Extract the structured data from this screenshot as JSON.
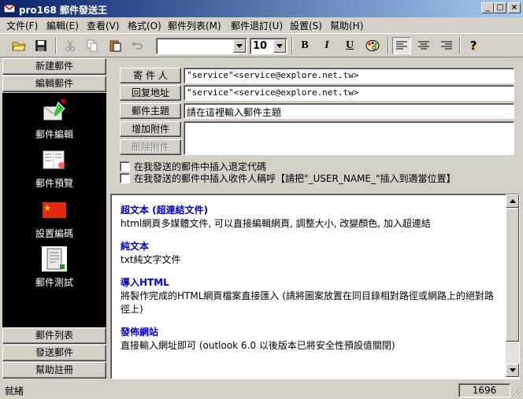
{
  "window": {
    "title": "pro168 郵件發送王",
    "controls": [
      "_",
      "□",
      "×"
    ]
  },
  "menu": [
    {
      "label": "文件(F)"
    },
    {
      "label": "編輯(E)"
    },
    {
      "label": "查看(V)"
    },
    {
      "label": "格式(O)"
    },
    {
      "label": "郵件列表(M)"
    },
    {
      "label": "郵件退訂(U)"
    },
    {
      "label": "設置(S)"
    },
    {
      "label": "幫助(H)"
    }
  ],
  "toolbar": {
    "font_name": "",
    "font_size": "10",
    "bold": "B",
    "italic": "I",
    "underline": "U",
    "help": "?"
  },
  "sidebar": {
    "top_tabs": [
      "新建郵件",
      "編輯郵件"
    ],
    "items": [
      {
        "label": "郵件編輯",
        "icon": "mail-edit-icon"
      },
      {
        "label": "郵件預覽",
        "icon": "book-icon"
      },
      {
        "label": "設置編碼",
        "icon": "flag-icon"
      },
      {
        "label": "郵件測試",
        "icon": "scroll-icon"
      }
    ],
    "bottom_tabs": [
      "郵件列表",
      "發送郵件",
      "幫助註冊"
    ]
  },
  "form": {
    "sender_label": "寄 件 人",
    "sender_value": "\"service\"<service@explore.net.tw>",
    "reply_label": "回复地址",
    "reply_value": "\"service\"<service@explore.net.tw>",
    "subject_label": "郵件主題",
    "subject_value": "請在這裡輸入郵件主題",
    "add_attachment": "增加附件",
    "remove_attachment": "刪除附件",
    "check_unsubscribe": "在我發送的郵件中插入退定代碼",
    "check_recipient": "在我發送的郵件中插入收件人稱呼【請把\"_USER_NAME_\"插入到適當位置】"
  },
  "content": {
    "sections": [
      {
        "title": "超文本 (超連結文件)",
        "desc": "html網頁多媒體文件, 可以直接編輯網頁, 調整大小, 改變顏色, 加入超連結"
      },
      {
        "title": "純文本",
        "desc": "txt純文字文件"
      },
      {
        "title": "導入HTML",
        "desc": "將製作完成的HTML網頁檔案直接匯入 (請將圖案放置在同目錄相對路徑或網路上的絕對路徑上)"
      },
      {
        "title": "發佈網站",
        "desc": "直接輸入網址即可 (outlook 6.0 以後版本已將安全性預設值關閉)"
      }
    ]
  },
  "status": {
    "text": "就緒",
    "count": "1696"
  },
  "colors": {
    "title_start": "#0a246a",
    "title_end": "#a6caf0",
    "link_blue": "#0000cc",
    "panel_bg": "#000000",
    "face": "#d4d0c8"
  }
}
